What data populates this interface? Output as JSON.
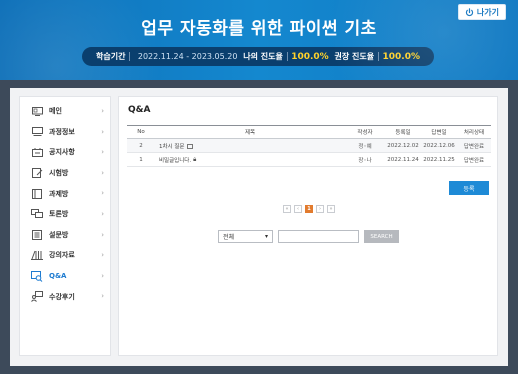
{
  "header": {
    "title": "업무 자동화를 위한 파이썬 기초",
    "exit_label": "나가기",
    "period_label": "학습기간",
    "period_value": "2022.11.24 - 2023.05.20",
    "my_progress_label": "나의 진도율",
    "my_progress_value": "100.0%",
    "recommended_progress_label": "권장 진도율",
    "recommended_progress_value": "100.0%"
  },
  "sidebar": {
    "items": [
      {
        "label": "메인",
        "icon": "monitor-icon"
      },
      {
        "label": "과정정보",
        "icon": "display-icon"
      },
      {
        "label": "공지사항",
        "icon": "notice-icon"
      },
      {
        "label": "시험방",
        "icon": "exam-icon"
      },
      {
        "label": "과제방",
        "icon": "assignment-icon"
      },
      {
        "label": "토론방",
        "icon": "discussion-icon"
      },
      {
        "label": "설문방",
        "icon": "survey-icon"
      },
      {
        "label": "강의자료",
        "icon": "books-icon"
      },
      {
        "label": "Q&A",
        "icon": "qa-icon",
        "active": true
      },
      {
        "label": "수강후기",
        "icon": "review-icon"
      }
    ]
  },
  "main": {
    "title": "Q&A",
    "columns": [
      "No",
      "제목",
      "작성자",
      "등록일",
      "답변일",
      "처리상태"
    ],
    "rows": [
      {
        "no": "2",
        "title": "1차시 질문",
        "author": "정◦예",
        "registered": "2022.12.02",
        "answered": "2022.12.06",
        "status": "답변완료"
      },
      {
        "no": "1",
        "title": "비밀글입니다.",
        "author": "장◦나",
        "registered": "2022.11.24",
        "answered": "2022.11.25",
        "status": "답변완료"
      }
    ],
    "register_label": "등록",
    "pager": {
      "first": "«",
      "prev": "‹",
      "current": "1",
      "next": "›",
      "last": "»"
    },
    "search": {
      "select_value": "전체",
      "button_label": "SEARCH"
    }
  },
  "colors": {
    "header_blue": "#1488cf",
    "progress_yellow": "#ffd22a",
    "active_blue": "#1e7bd0",
    "page_orange": "#e27b2e"
  }
}
